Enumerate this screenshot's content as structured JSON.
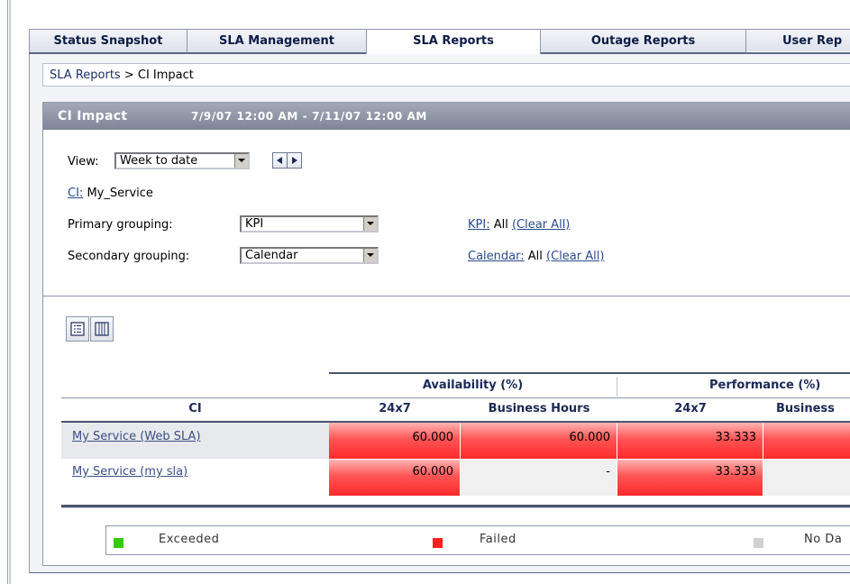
{
  "tabs": [
    {
      "label": "Status Snapshot",
      "active": false
    },
    {
      "label": "SLA Management",
      "active": false
    },
    {
      "label": "SLA Reports",
      "active": true
    },
    {
      "label": "Outage Reports",
      "active": false
    },
    {
      "label": "User Rep",
      "active": false
    }
  ],
  "breadcrumb": {
    "parent": "SLA Reports",
    "separator": ">",
    "current": "CI Impact"
  },
  "panel": {
    "title": "CI Impact",
    "date_range": "7/9/07 12:00 AM - 7/11/07 12:00 AM"
  },
  "filters": {
    "view_label": "View:",
    "view_value": "Week to date",
    "ci_link": "CI:",
    "ci_value": "My_Service",
    "primary_label": "Primary grouping:",
    "primary_value": "KPI",
    "secondary_label": "Secondary grouping:",
    "secondary_value": "Calendar",
    "kpi_link": "KPI:",
    "kpi_value": "All",
    "kpi_clear": "(Clear All)",
    "calendar_link": "Calendar:",
    "calendar_value": "All",
    "calendar_clear": "(Clear All)"
  },
  "table": {
    "groups": [
      "Availability (%)",
      "Performance (%)"
    ],
    "ci_header": "CI",
    "columns": [
      "24x7",
      "Business Hours",
      "24x7",
      "Business"
    ],
    "rows": [
      {
        "ci": "My Service (Web SLA)",
        "values": [
          "60.000",
          "60.000",
          "33.333",
          ""
        ],
        "status": [
          "failed",
          "failed",
          "failed",
          "failed"
        ]
      },
      {
        "ci": "My Service (my sla)",
        "values": [
          "60.000",
          "-",
          "33.333",
          ""
        ],
        "status": [
          "failed",
          "none",
          "failed",
          "none"
        ]
      }
    ]
  },
  "legend": [
    {
      "label": "Exceeded",
      "color": "#33cc00"
    },
    {
      "label": "Failed",
      "color": "#ff2020"
    },
    {
      "label": "No Da",
      "color": "#d0d0d0"
    }
  ],
  "icons": [
    "list-view-icon",
    "column-view-icon",
    "prev-arrow-icon",
    "next-arrow-icon"
  ]
}
